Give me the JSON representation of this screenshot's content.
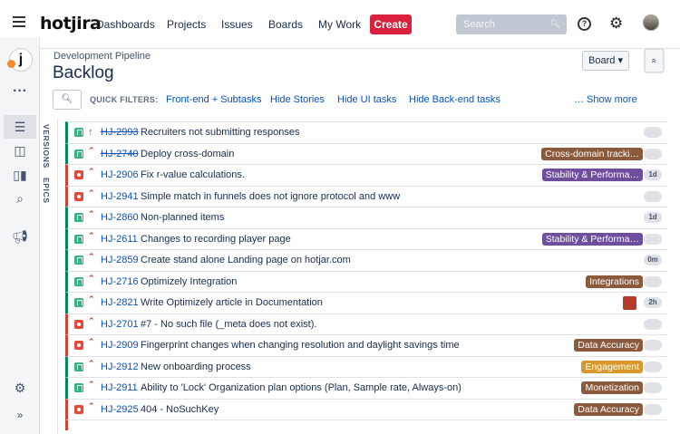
{
  "topbar": {
    "logo": "hotjira",
    "nav": [
      "Dashboards",
      "Projects",
      "Issues",
      "Boards",
      "My Work"
    ],
    "create_label": "Create",
    "search_placeholder": "Search",
    "search_icon": "magnifier-icon",
    "help_icon": "?"
  },
  "project": {
    "logo_letter": "j",
    "breadcrumb": "Development Pipeline",
    "title": "Backlog",
    "board_button": "Board ▾",
    "collapse_button": "»"
  },
  "sidebar": {
    "icons": [
      "more-icon",
      "backlog-icon",
      "board-icon",
      "reports-icon",
      "issues-icon",
      "releases-icon",
      "settings-icon",
      "expand-icon"
    ]
  },
  "quick_filters": {
    "label": "QUICK FILTERS:",
    "items": [
      "Front-end + Subtasks",
      "Hide Stories",
      "Hide UI tasks",
      "Hide Back-end tasks",
      "… Show more"
    ]
  },
  "vertical_tabs": [
    "VERSIONS",
    "EPICS"
  ],
  "colors": {
    "create": "#d9213d",
    "story": "#36b37e",
    "bug": "#e5493a",
    "epic_brown": "#8b5a3c",
    "epic_purple": "#6e4e9d",
    "epic_gold": "#d9982b",
    "link": "#0052cc"
  },
  "issues": [
    {
      "type": "story",
      "priority": "↑",
      "key": "HJ-2993",
      "done": true,
      "summary": "Recruiters not submitting responses",
      "epic": "",
      "epic_color": "",
      "estimate": "",
      "assignee": false
    },
    {
      "type": "story",
      "priority": "⌃",
      "key": "HJ-2740",
      "done": true,
      "summary": "Deploy cross-domain",
      "epic": "Cross-domain tracki…",
      "epic_color": "#8b5a3c",
      "estimate": "",
      "assignee": false
    },
    {
      "type": "bug",
      "priority": "⌃",
      "key": "HJ-2906",
      "done": false,
      "summary": "Fix r-value calculations.",
      "epic": "Stability & Performa…",
      "epic_color": "#6e4e9d",
      "estimate": "1d",
      "assignee": false
    },
    {
      "type": "bug",
      "priority": "⌃",
      "key": "HJ-2941",
      "done": false,
      "summary": "Simple match in funnels does not ignore protocol and www",
      "epic": "",
      "epic_color": "",
      "estimate": "",
      "assignee": false
    },
    {
      "type": "story",
      "priority": "⌃",
      "key": "HJ-2860",
      "done": false,
      "summary": "Non-planned items",
      "epic": "",
      "epic_color": "",
      "estimate": "1d",
      "assignee": false
    },
    {
      "type": "story",
      "priority": "⌃",
      "key": "HJ-2611",
      "done": false,
      "summary": "Changes to recording player page",
      "epic": "Stability & Performa…",
      "epic_color": "#6e4e9d",
      "estimate": "",
      "assignee": false
    },
    {
      "type": "story",
      "priority": "⌃",
      "key": "HJ-2859",
      "done": false,
      "summary": "Create stand alone Landing page on hotjar.com",
      "epic": "",
      "epic_color": "",
      "estimate": "0m",
      "assignee": false
    },
    {
      "type": "story",
      "priority": "⌃",
      "key": "HJ-2716",
      "done": false,
      "summary": "Optimizely Integration",
      "epic": "Integrations",
      "epic_color": "#8b5a3c",
      "estimate": "",
      "assignee": false
    },
    {
      "type": "story",
      "priority": "⌃",
      "key": "HJ-2821",
      "done": false,
      "summary": "Write Optimizely article in Documentation",
      "epic": "",
      "epic_color": "",
      "estimate": "2h",
      "assignee": true
    },
    {
      "type": "bug",
      "priority": "⌃",
      "key": "HJ-2701",
      "done": false,
      "summary": "#7 - No such file (_meta does not exist).",
      "epic": "",
      "epic_color": "",
      "estimate": "",
      "assignee": false
    },
    {
      "type": "bug",
      "priority": "⌃",
      "key": "HJ-2909",
      "done": false,
      "summary": "Fingerprint changes when changing resolution and daylight savings time",
      "epic": "Data Accuracy",
      "epic_color": "#8b5a3c",
      "estimate": "",
      "assignee": false
    },
    {
      "type": "story",
      "priority": "⌃",
      "key": "HJ-2912",
      "done": false,
      "summary": "New onboarding process",
      "epic": "Engagement",
      "epic_color": "#d9982b",
      "estimate": "",
      "assignee": false
    },
    {
      "type": "story",
      "priority": "⌃",
      "key": "HJ-2911",
      "done": false,
      "summary": "Ability to 'Lock' Organization plan options (Plan, Sample rate, Always-on)",
      "epic": "Monetization",
      "epic_color": "#8b5a3c",
      "estimate": "",
      "assignee": false
    },
    {
      "type": "bug",
      "priority": "⌃",
      "key": "HJ-2925",
      "done": false,
      "summary": "404 - NoSuchKey",
      "epic": "Data Accuracy",
      "epic_color": "#8b5a3c",
      "estimate": "",
      "assignee": false
    }
  ]
}
